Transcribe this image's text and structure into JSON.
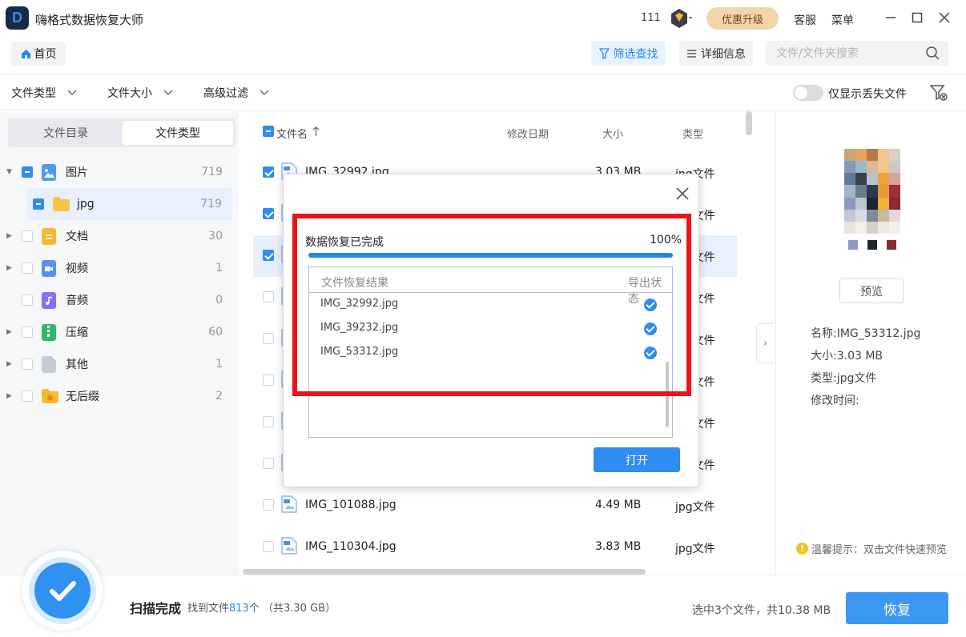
{
  "app": {
    "title": "嗨格式数据恢复大师",
    "logo_letter": "D",
    "counter": "111",
    "upgrade_label": "优惠升级",
    "service_label": "客服",
    "menu_label": "菜单"
  },
  "toolbar": {
    "home_label": "首页",
    "filter_search_label": "筛选查找",
    "detail_label": "详细信息",
    "search_placeholder": "文件/文件夹搜索"
  },
  "filters": {
    "file_type": "文件类型",
    "file_size": "文件大小",
    "advanced": "高级过滤",
    "only_lost_label": "仅显示丢失文件"
  },
  "sidebar": {
    "tabs": [
      "文件目录",
      "文件类型"
    ],
    "items": [
      {
        "label": "图片",
        "count": "719",
        "icon": "image-icon"
      },
      {
        "label": "jpg",
        "count": "719",
        "icon": "folder-icon"
      },
      {
        "label": "文档",
        "count": "30",
        "icon": "document-icon"
      },
      {
        "label": "视频",
        "count": "1",
        "icon": "video-icon"
      },
      {
        "label": "音频",
        "count": "0",
        "icon": "audio-icon"
      },
      {
        "label": "压缩",
        "count": "60",
        "icon": "archive-icon"
      },
      {
        "label": "其他",
        "count": "1",
        "icon": "other-icon"
      },
      {
        "label": "无后缀",
        "count": "2",
        "icon": "no-extension-icon"
      }
    ]
  },
  "file_list": {
    "headers": {
      "name": "文件名",
      "date": "修改日期",
      "size": "大小",
      "type": "类型"
    },
    "rows": [
      {
        "name": "IMG_32992.jpg",
        "size": "3.03 MB",
        "type": "jpg文件",
        "checked": true
      },
      {
        "name": "",
        "size": "",
        "type": "jpg文件",
        "checked": true
      },
      {
        "name": "",
        "size": "",
        "type": "jpg文件",
        "checked": true
      },
      {
        "name": "",
        "size": "",
        "type": "jpg文件",
        "checked": false
      },
      {
        "name": "",
        "size": "",
        "type": "jpg文件",
        "checked": false
      },
      {
        "name": "",
        "size": "",
        "type": "jpg文件",
        "checked": false
      },
      {
        "name": "",
        "size": "",
        "type": "jpg文件",
        "checked": false
      },
      {
        "name": "",
        "size": "",
        "type": "jpg文件",
        "checked": false
      },
      {
        "name": "IMG_101088.jpg",
        "size": "4.49 MB",
        "type": "jpg文件",
        "checked": false
      },
      {
        "name": "IMG_110304.jpg",
        "size": "3.83 MB",
        "type": "jpg文件",
        "checked": false
      }
    ]
  },
  "preview_panel": {
    "preview_label": "预览",
    "name_line": "名称:IMG_53312.jpg",
    "size_line": "大小:3.03 MB",
    "type_line": "类型:jpg文件",
    "modified_line": "修改时间:",
    "tip": "温馨提示：双击文件快速预览",
    "swatches": [
      "#8f96c8",
      "#1c2530",
      "#8a2a33"
    ]
  },
  "bottom": {
    "scan_done": "扫描完成",
    "found_prefix": "找到文件",
    "found_count": "813",
    "found_suffix": "个",
    "total": "（共3.30 GB）",
    "selected_info": "选中3个文件，共10.38 MB",
    "recover_label": "恢复"
  },
  "modal": {
    "status": "数据恢复已完成",
    "percent": "100%",
    "progress": 1.0,
    "col_result": "文件恢复结果",
    "col_status": "导出状态",
    "files": [
      "IMG_32992.jpg",
      "IMG_39232.jpg",
      "IMG_53312.jpg"
    ],
    "open_label": "打开"
  },
  "colors": {
    "accent": "#2f8cf0",
    "highlight_border": "#e8141b",
    "upgrade_bg": "#f0d6a8"
  }
}
